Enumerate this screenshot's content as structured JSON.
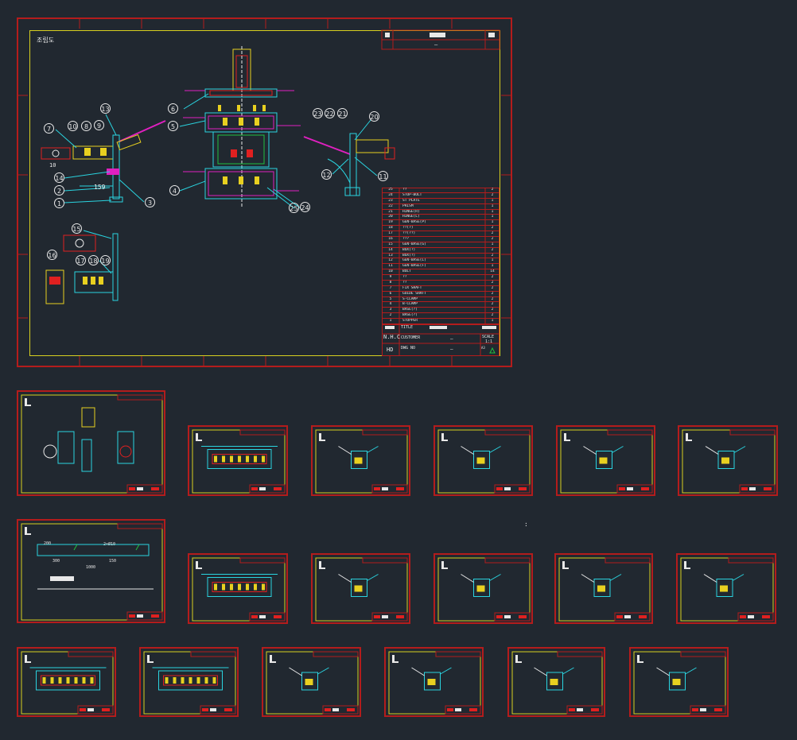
{
  "main_sheet": {
    "view_label": "조립도",
    "balloons": [
      "1",
      "2",
      "3",
      "4",
      "5",
      "6",
      "7",
      "8",
      "9",
      "10",
      "11",
      "12",
      "13",
      "14",
      "15",
      "16",
      "17",
      "18",
      "19",
      "20",
      "21",
      "22",
      "23",
      "24",
      "25"
    ],
    "dimension_159": "159",
    "dimension_10": "10",
    "parts_list": [
      [
        "25",
        "??",
        "2"
      ],
      [
        "24",
        "STOP-BOLT",
        "2"
      ],
      [
        "23",
        "ST PLATE",
        "1"
      ],
      [
        "22",
        "PRISM",
        "1"
      ],
      [
        "21",
        "HINGE(R)",
        "1"
      ],
      [
        "20",
        "HINGE(L)",
        "1"
      ],
      [
        "19",
        "GEN-BASE(P)",
        "1"
      ],
      [
        "18",
        "??(?)",
        "2"
      ],
      [
        "17",
        "??(??)",
        "2"
      ],
      [
        "16",
        "???",
        "2"
      ],
      [
        "15",
        "GEN-BASE(G)",
        "1"
      ],
      [
        "14",
        "BOX(?)",
        "2"
      ],
      [
        "13",
        "BOX(?)",
        "2"
      ],
      [
        "12",
        "GEN-BASE(L)",
        "1"
      ],
      [
        "11",
        "GEN-BASE(F)",
        "1"
      ],
      [
        "10",
        "BOLT",
        "14"
      ],
      [
        "9",
        "??",
        "2"
      ],
      [
        "8",
        "??",
        "2"
      ],
      [
        "7",
        "FIX SHAFT",
        "2"
      ],
      [
        "6",
        "GUIDE SHAFT",
        "2"
      ],
      [
        "5",
        "S-CLAMP",
        "2"
      ],
      [
        "4",
        "B-CLAMP",
        "2"
      ],
      [
        "3",
        "BASE(?)",
        "2"
      ],
      [
        "2",
        "BASE(?)",
        "2"
      ],
      [
        "1",
        "STOPPER",
        "1"
      ]
    ],
    "title_block": {
      "company": "N.H.C",
      "sub": "HD",
      "title_label": "TITLE",
      "customer_label": "CUSTOMER",
      "dwg_label": "DWG NO",
      "scale_label": "SCALE",
      "scale_value": "1:1",
      "dash": "–",
      "size": "A3"
    },
    "revision_dash": "–"
  },
  "small_labels": {
    "dim_200": "200",
    "dim_2x10": "2×Ø10",
    "dim_300": "300",
    "dim_150": "150",
    "dim_1000": "1000",
    "dot": ":"
  },
  "colors": {
    "background": "#212830",
    "frame_red": "#b41c1c",
    "border_yellow": "#d8d020",
    "cyan": "#2ad4e0",
    "magenta": "#e020c0",
    "green": "#20c040",
    "yellow": "#e8d020",
    "white": "#e8e8e8",
    "blue": "#3060f0"
  }
}
